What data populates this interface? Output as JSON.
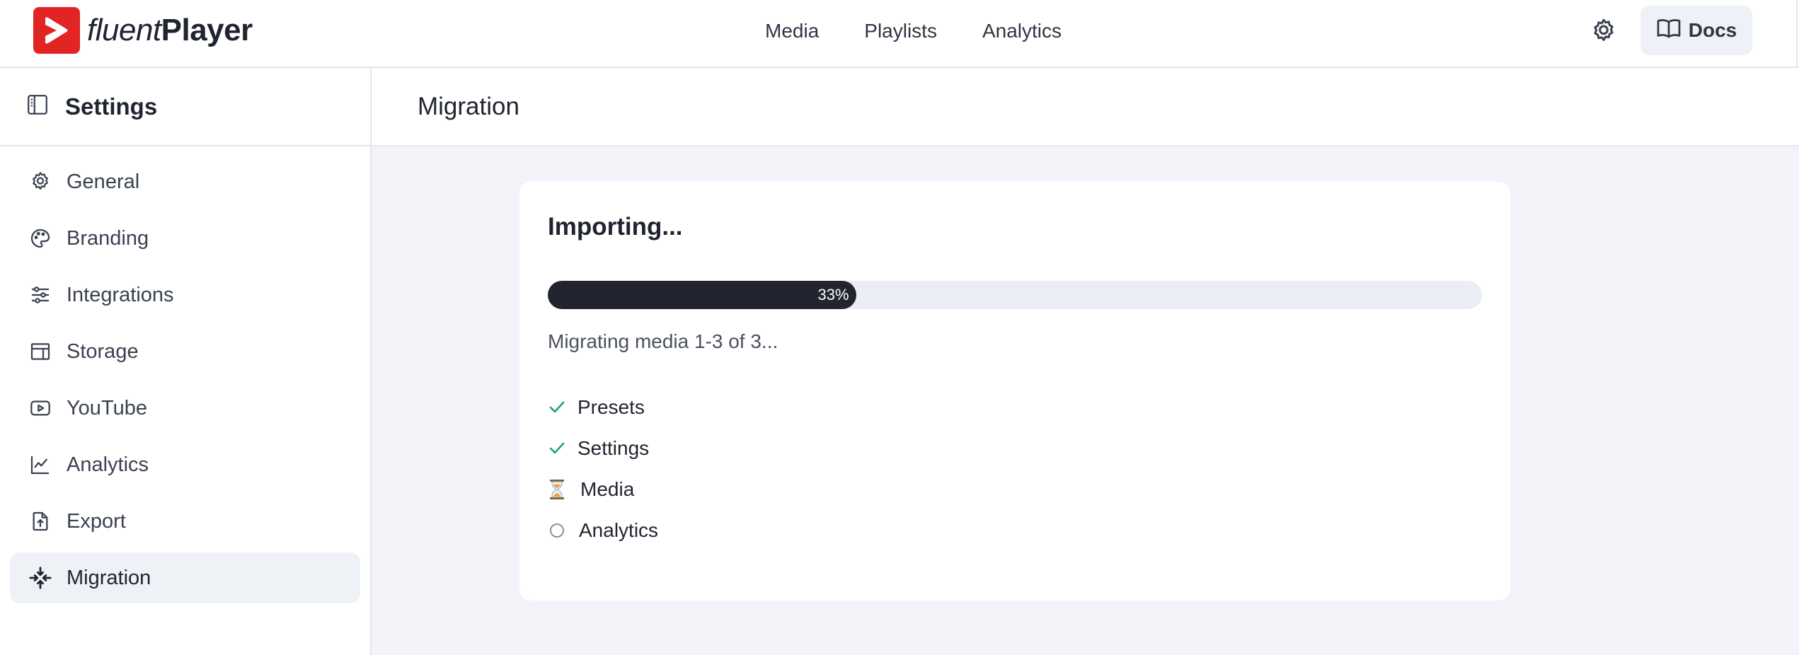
{
  "app": {
    "brand_light": "fluent",
    "brand_bold": "Player",
    "brand_color": "#e32424"
  },
  "topnav": {
    "items": [
      {
        "label": "Media"
      },
      {
        "label": "Playlists"
      },
      {
        "label": "Analytics"
      }
    ],
    "docs_label": "Docs"
  },
  "sidebar": {
    "title": "Settings",
    "items": [
      {
        "label": "General",
        "icon": "gear-icon"
      },
      {
        "label": "Branding",
        "icon": "palette-icon"
      },
      {
        "label": "Integrations",
        "icon": "sliders-icon"
      },
      {
        "label": "Storage",
        "icon": "storage-icon"
      },
      {
        "label": "YouTube",
        "icon": "youtube-icon"
      },
      {
        "label": "Analytics",
        "icon": "chart-line-icon"
      },
      {
        "label": "Export",
        "icon": "export-icon"
      },
      {
        "label": "Migration",
        "icon": "migration-icon",
        "active": true
      }
    ]
  },
  "main": {
    "title": "Migration",
    "card": {
      "heading": "Importing...",
      "progress": {
        "value": 33,
        "label": "33%"
      },
      "status": "Migrating media 1-3 of 3...",
      "steps": [
        {
          "label": "Presets",
          "state": "done",
          "icon": "check-icon"
        },
        {
          "label": "Settings",
          "state": "done",
          "icon": "check-icon"
        },
        {
          "label": "Media",
          "state": "in-progress",
          "icon": "hourglass-icon"
        },
        {
          "label": "Analytics",
          "state": "pending",
          "icon": "circle-icon"
        }
      ]
    }
  },
  "colors": {
    "check": "#1aa86a",
    "progress_fill": "#22252f",
    "progress_track": "#eaedf4",
    "active_nav_bg": "#eef1f6",
    "page_bg": "#f3f4f9"
  }
}
